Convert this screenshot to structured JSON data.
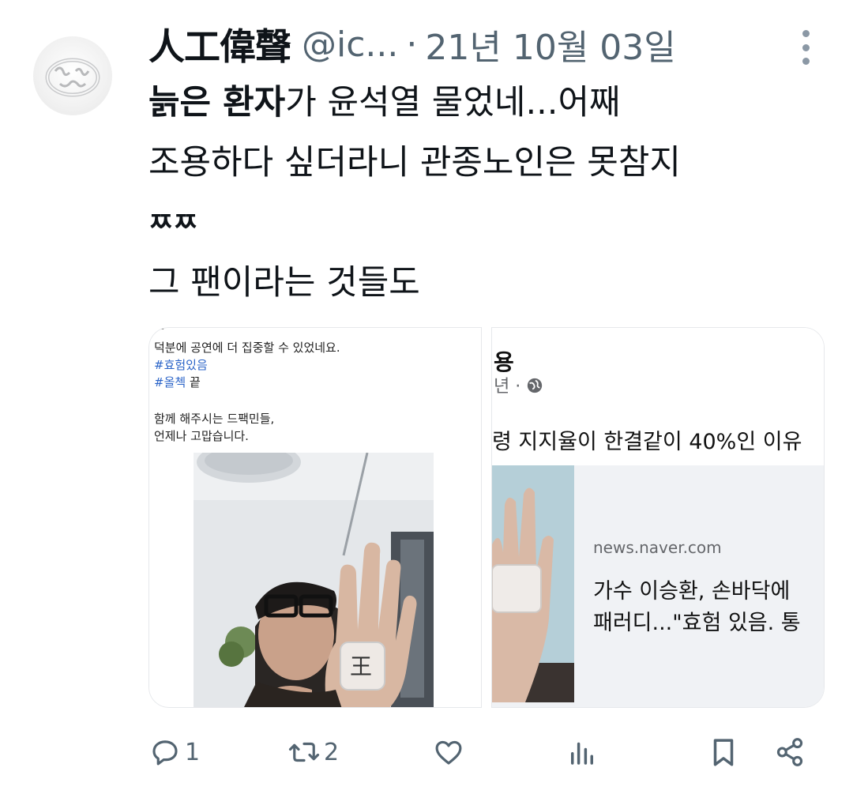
{
  "tweet": {
    "author_name": "人工偉聲",
    "handle": "@ic...",
    "separator": "·",
    "date": "21년 10월 03일",
    "text": {
      "bold_part": "늙은 환자",
      "line1_rest": "가 윤석열 물었네...어째",
      "line2": "조용하다 싶더라니 관종노인은 못참지",
      "line3": "ㅉㅉ",
      "line4": "그 팬이라는 것들도"
    }
  },
  "media": {
    "left": {
      "post_lines": [
        "덕분에 공연에 더 집중할 수 있었네요.",
        "#효험있음",
        "#올첵 끝",
        "함께 해주시는 드팩민들,",
        "언제나 고맙습니다."
      ],
      "tag1": "#효험있음",
      "tag2": "#올첵",
      "tag2_rest": " 끝",
      "line_a": "덕분에 공연에 더 집중할 수 있었네요.",
      "line_b": "함께 해주시는 드팩민들,",
      "line_c": "언제나 고맙습니다.",
      "palm_text": "王"
    },
    "right": {
      "title_fragment": "용",
      "sub_fragment": "년 ·",
      "globe_icon": "globe-icon",
      "headline": "령 지지율이 한결같이 40%인 이유",
      "domain": "news.naver.com",
      "link_title_1": "가수 이승환, 손바닥에",
      "link_title_2": "패러디...\"효험 있음. 통"
    }
  },
  "actions": {
    "reply_count": "1",
    "retweet_count": "2",
    "icons": [
      "reply-icon",
      "retweet-icon",
      "like-icon",
      "views-icon",
      "bookmark-icon",
      "share-icon"
    ]
  },
  "colors": {
    "text": "#0f1419",
    "secondary": "#536471",
    "hashtag": "#2b64c8"
  }
}
